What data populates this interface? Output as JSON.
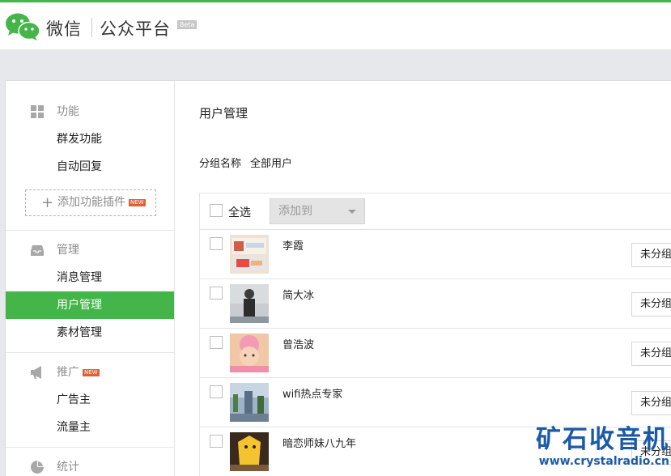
{
  "header": {
    "brand": "微信",
    "platform": "公众平台",
    "beta": "Beta"
  },
  "sidebar": {
    "function": {
      "heading": "功能",
      "items": [
        "群发功能",
        "自动回复"
      ],
      "add_plugin": "添加功能插件",
      "new_badge": "NEW"
    },
    "manage": {
      "heading": "管理",
      "items": [
        "消息管理",
        "用户管理",
        "素材管理"
      ],
      "active": "用户管理"
    },
    "promote": {
      "heading": "推广",
      "new_badge": "NEW",
      "items": [
        "广告主",
        "流量主"
      ]
    },
    "stats": {
      "heading": "统计"
    }
  },
  "main": {
    "title": "用户管理",
    "group_label": "分组名称",
    "group_value": "全部用户",
    "select_all": "全选",
    "add_to": "添加到",
    "users": [
      {
        "name": "李霞",
        "group": "未分组"
      },
      {
        "name": "简大冰",
        "group": "未分组"
      },
      {
        "name": "曾浩波",
        "group": "未分组"
      },
      {
        "name": "wifi热点专家",
        "group": "未分组"
      },
      {
        "name": "暗恋师妹八九年",
        "group": "未分组"
      }
    ]
  },
  "watermark": {
    "title": "矿石收音机",
    "url": "www.crystalradio.cn"
  },
  "colors": {
    "accent": "#44b549",
    "new_badge": "#e15f34",
    "watermark": "#1b5aa8"
  }
}
